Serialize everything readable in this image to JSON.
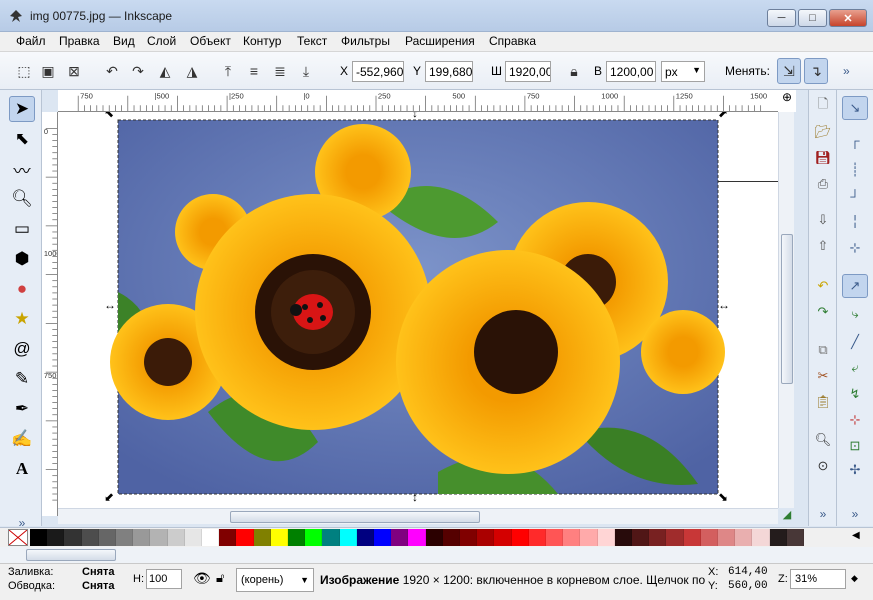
{
  "window": {
    "title": "img 00775.jpg — Inkscape",
    "min": "─",
    "max": "□",
    "close": "✕"
  },
  "menu": [
    "Файл",
    "Правка",
    "Вид",
    "Слой",
    "Объект",
    "Контур",
    "Текст",
    "Фильтры",
    "Расширения",
    "Справка"
  ],
  "toolbar": {
    "x_label": "X",
    "x_value": "-552,960",
    "y_label": "Y",
    "y_value": "199,680",
    "w_label": "Ш",
    "w_value": "1920,00",
    "h_label": "В",
    "h_value": "1200,00",
    "unit": "px",
    "change_label": "Менять:",
    "more": "»"
  },
  "ruler_h": [
    "750",
    "|500",
    "|250",
    "|0",
    "250",
    "500",
    "750",
    "1000",
    "1250",
    "1500"
  ],
  "ruler_v": [
    "0",
    "1000",
    "750"
  ],
  "colors": {
    "accent": "#c2d5ee",
    "chrome": "#dce6f2"
  },
  "palette": [
    "#000000",
    "#1a1a1a",
    "#333333",
    "#4d4d4d",
    "#666666",
    "#808080",
    "#999999",
    "#b3b3b3",
    "#cccccc",
    "#e6e6e6",
    "#ffffff",
    "#800000",
    "#ff0000",
    "#808000",
    "#ffff00",
    "#008000",
    "#00ff00",
    "#008080",
    "#00ffff",
    "#000080",
    "#0000ff",
    "#800080",
    "#ff00ff",
    "#2b0000",
    "#550000",
    "#800000",
    "#aa0000",
    "#d40000",
    "#ff0000",
    "#ff2a2a",
    "#ff5555",
    "#ff8080",
    "#ffaaaa",
    "#ffd5d5",
    "#280b0b",
    "#501616",
    "#782121",
    "#a02c2c",
    "#c83737",
    "#d35f5f",
    "#de8787",
    "#e9afaf",
    "#f4d7d7",
    "#241c1c",
    "#483737"
  ],
  "status": {
    "fill_label": "Заливка:",
    "fill_value": "Снята",
    "stroke_label": "Обводка:",
    "stroke_value": "Снята",
    "opacity_label": "Н:",
    "opacity_value": "100",
    "layer": "(корень)",
    "message_bold": "Изображение",
    "message": " 1920 × 1200: включенное в корневом слое. Щелчок по",
    "x_coord_label": "X:",
    "x_coord": "614,40",
    "y_coord_label": "Y:",
    "y_coord": "560,00",
    "zoom_label": "Z:",
    "zoom": "31%"
  }
}
